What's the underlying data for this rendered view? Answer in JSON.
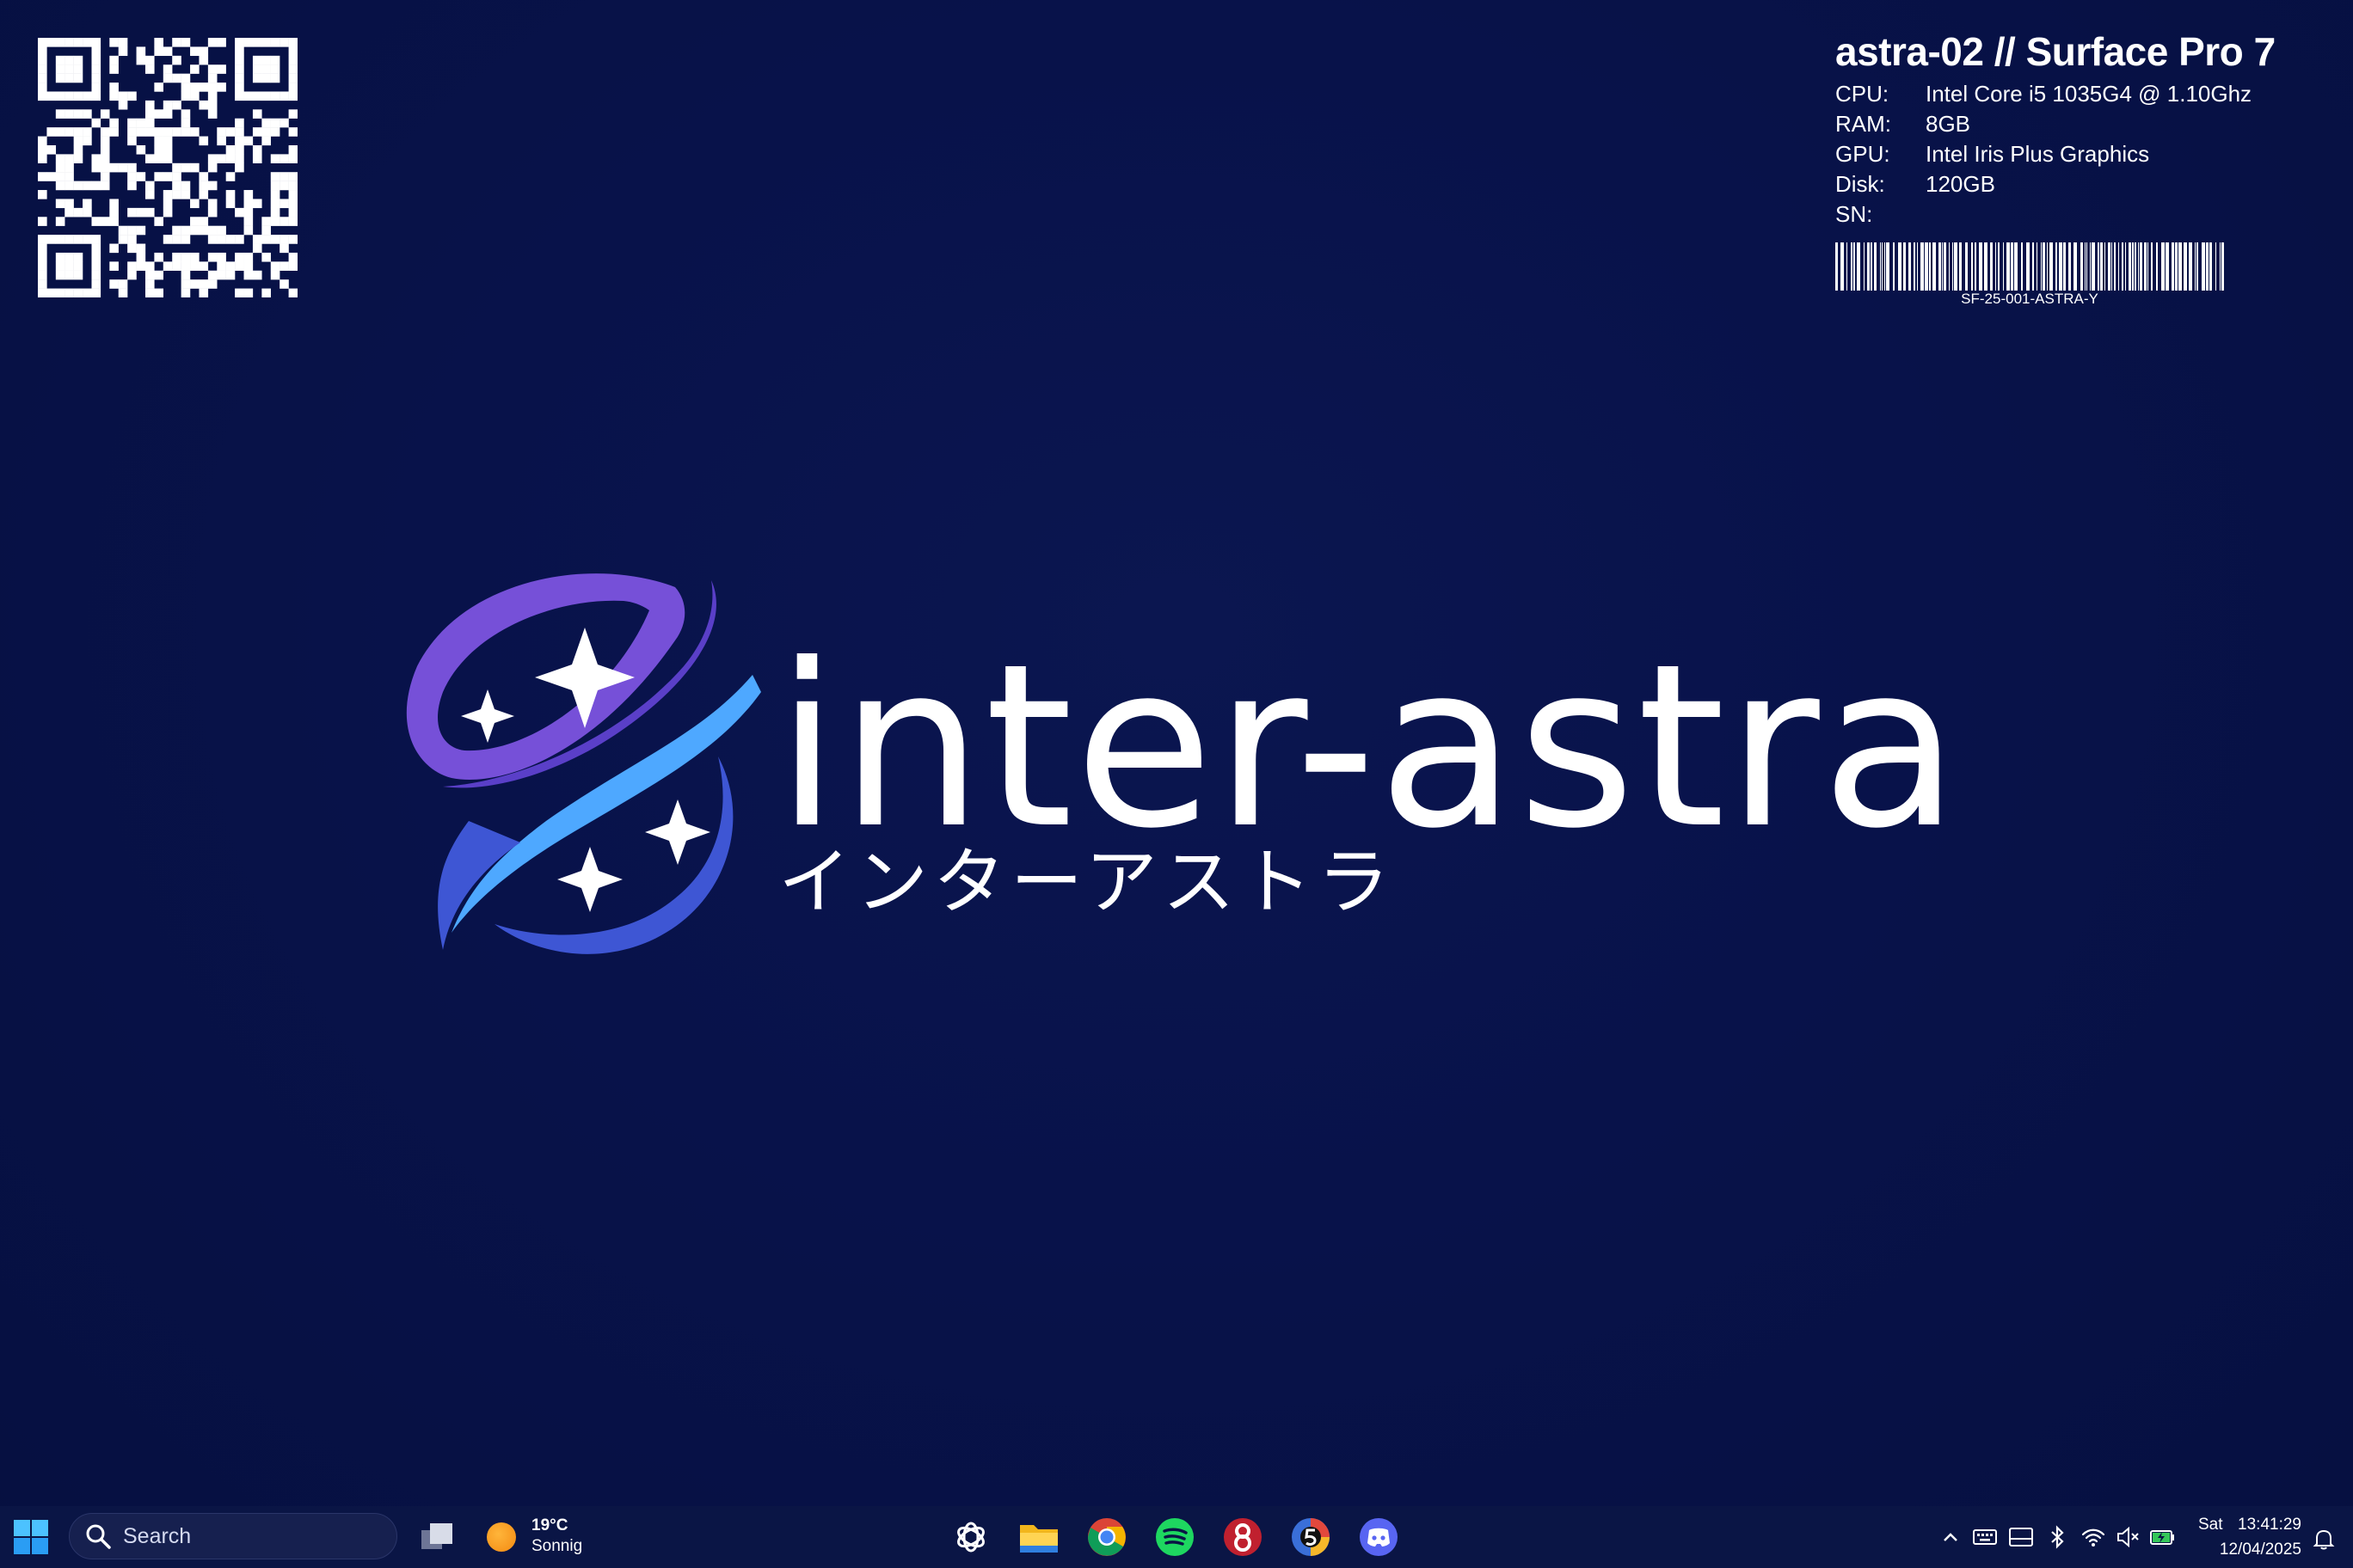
{
  "device": {
    "title": "astra-02 // Surface Pro 7",
    "specs": [
      {
        "label": "CPU:",
        "value": "Intel Core i5 1035G4 @ 1.10Ghz"
      },
      {
        "label": "RAM:",
        "value": "8GB"
      },
      {
        "label": "GPU:",
        "value": "Intel Iris Plus Graphics"
      },
      {
        "label": "Disk:",
        "value": "120GB"
      },
      {
        "label": "SN:",
        "value": ""
      }
    ],
    "serial": "SF-25-001-ASTRA-Y"
  },
  "logo": {
    "wordmark": "inter-astra",
    "wordmark_jp": "インターアストラ",
    "colors": {
      "purple": "#7b4fd6",
      "blue": "#3d57d6",
      "light_blue": "#4ea8ff"
    }
  },
  "desktop": {
    "background": "#08124a",
    "qr_code_icon": "qr-code-icon"
  },
  "taskbar": {
    "search_label": "Search",
    "weather": {
      "temp": "19°C",
      "desc": "Sonnig"
    },
    "apps": [
      {
        "name": "chatgpt",
        "icon": "chatgpt-icon"
      },
      {
        "name": "file-explorer",
        "icon": "folder-icon"
      },
      {
        "name": "chrome",
        "icon": "chrome-icon"
      },
      {
        "name": "spotify",
        "icon": "spotify-icon"
      },
      {
        "name": "app-red-8",
        "icon": "red-app-icon"
      },
      {
        "name": "app-5",
        "icon": "five-app-icon"
      },
      {
        "name": "discord",
        "icon": "discord-icon"
      }
    ],
    "clock": {
      "day": "Sat",
      "time": "13:41:29",
      "date": "12/04/2025"
    }
  }
}
